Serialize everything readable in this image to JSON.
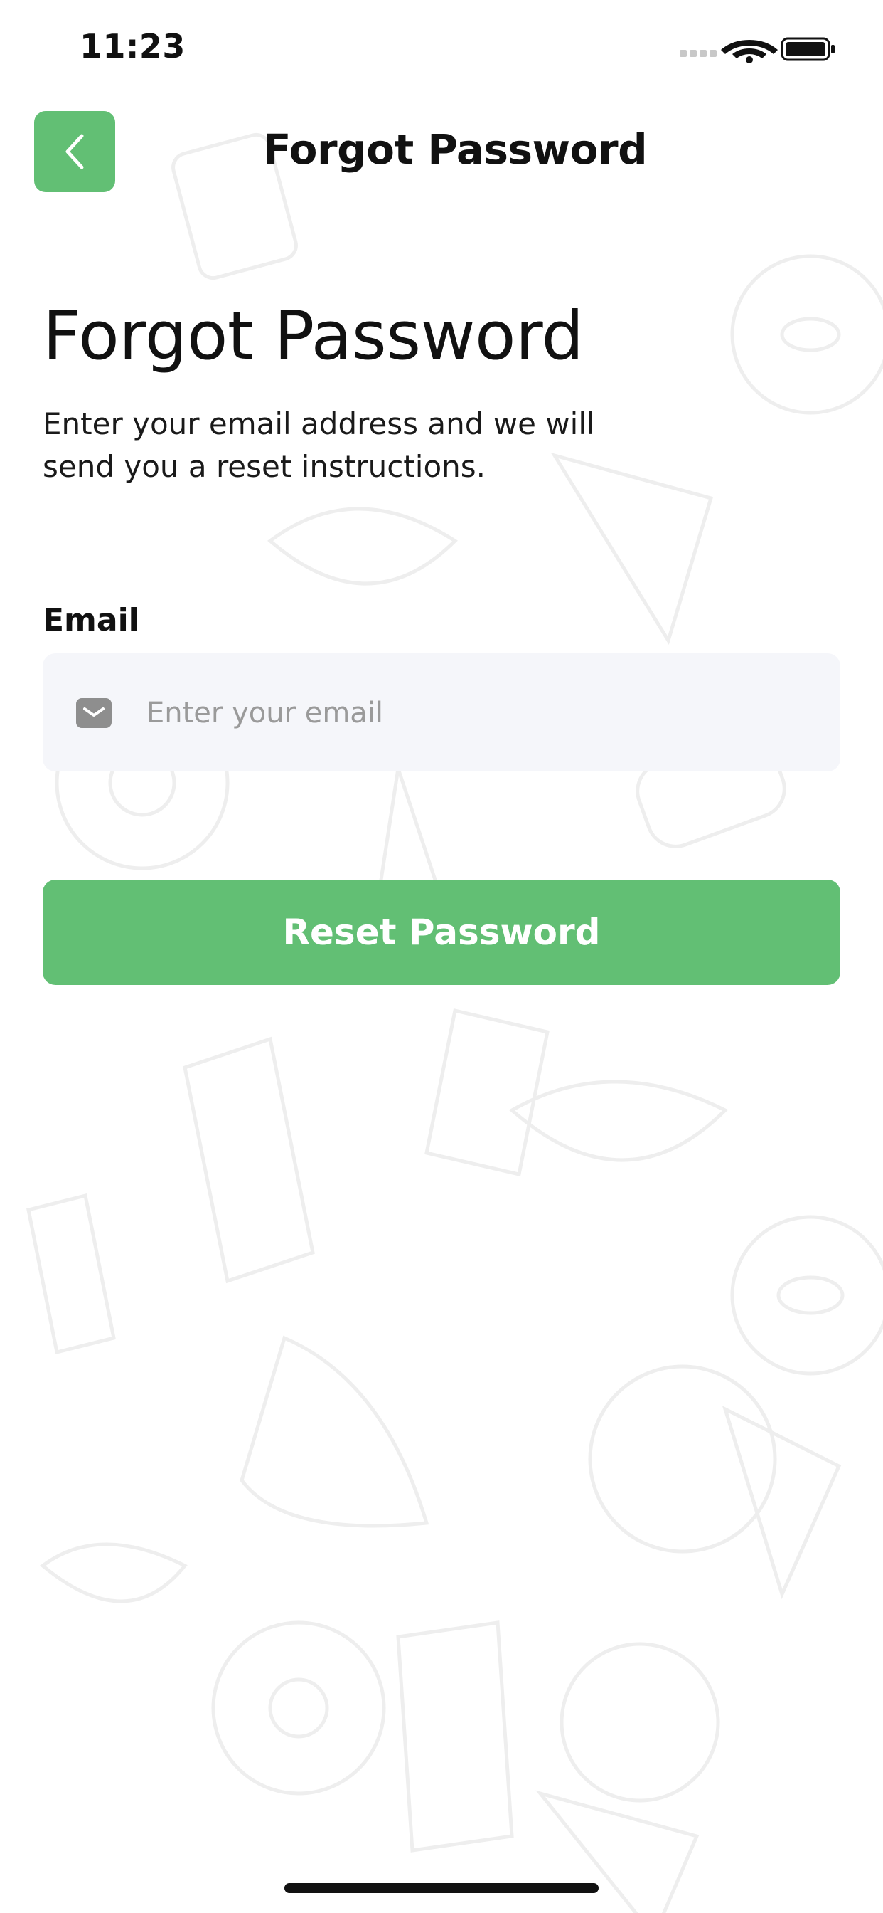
{
  "status_bar": {
    "time": "11:23"
  },
  "nav": {
    "title": "Forgot Password"
  },
  "content": {
    "heading": "Forgot Password",
    "subtitle_line1": "Enter your email address and we will",
    "subtitle_line2": "send you a reset instructions."
  },
  "form": {
    "email_label": "Email",
    "email_placeholder": "Enter your email",
    "email_value": ""
  },
  "actions": {
    "reset_label": "Reset Password"
  },
  "colors": {
    "accent": "#62bf74",
    "field_bg": "#f5f6fa",
    "background": "#ffffff"
  },
  "icons": {
    "back": "chevron-left-icon",
    "mail": "mail-icon",
    "wifi": "wifi-icon",
    "battery": "battery-icon",
    "signal": "cellular-signal-icon"
  }
}
